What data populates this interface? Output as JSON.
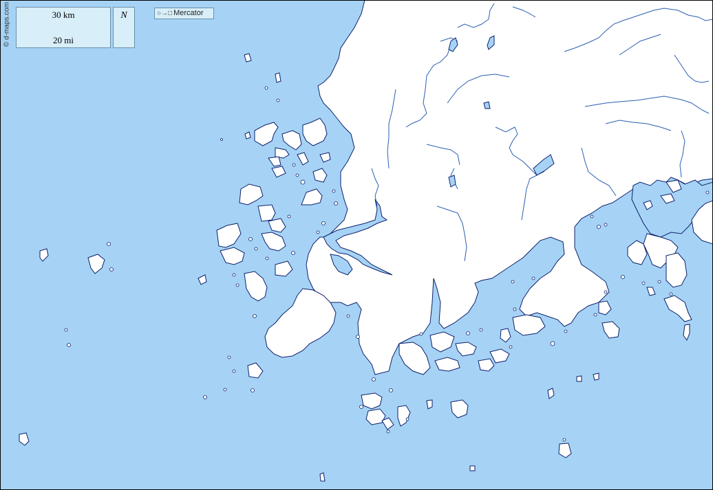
{
  "map": {
    "colors": {
      "sea": "#a6d3f5",
      "land": "#ffffff",
      "coast": "#0b1f6b",
      "river": "#2a5db0"
    }
  },
  "scale": {
    "km_label": "30 km",
    "mi_label": "20 mi"
  },
  "north_arrow": {
    "letter": "N"
  },
  "projection": {
    "icon": "circle-to-square-icon",
    "label": "Mercator"
  },
  "credit": "© d-maps.com"
}
